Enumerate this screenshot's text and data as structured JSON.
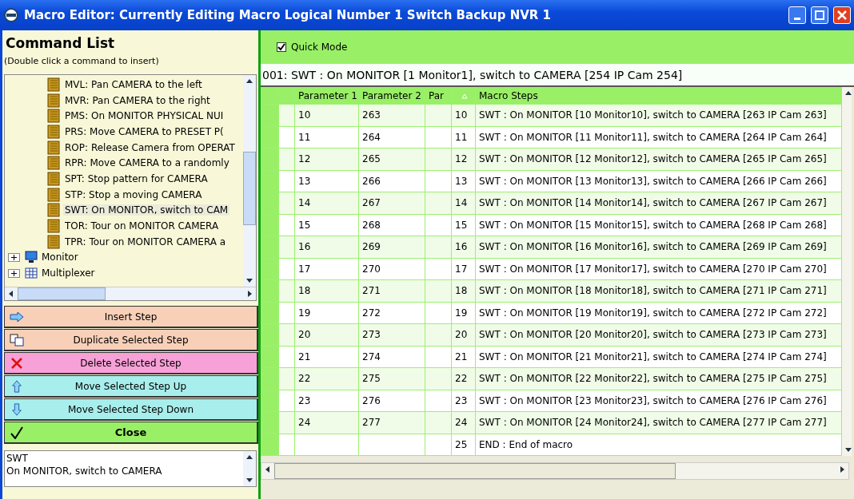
{
  "window": {
    "title": "Macro Editor: Currently Editing Macro Logical Number 1 Switch Backup NVR 1"
  },
  "command_list": {
    "title": "Command List",
    "hint": "(Double click a command to insert)",
    "commands": [
      {
        "label": "MVL: Pan CAMERA to the left",
        "selected": false
      },
      {
        "label": "MVR: Pan CAMERA to the right",
        "selected": false
      },
      {
        "label": "PMS: On MONITOR PHYSICAL NUI",
        "selected": false
      },
      {
        "label": "PRS: Move CAMERA to PRESET P(",
        "selected": false
      },
      {
        "label": "ROP: Release Camera from OPERAT",
        "selected": false
      },
      {
        "label": "RPR: Move CAMERA to a randomly",
        "selected": false
      },
      {
        "label": "SPT: Stop pattern for CAMERA",
        "selected": false
      },
      {
        "label": "STP: Stop a moving CAMERA",
        "selected": false
      },
      {
        "label": "SWT: On MONITOR, switch to CAM",
        "selected": true
      },
      {
        "label": "TOR: Tour on MONITOR CAMERA",
        "selected": false
      },
      {
        "label": "TPR: Tour on MONITOR CAMERA a",
        "selected": false
      }
    ],
    "groups": [
      {
        "label": "Monitor",
        "kind": "monitor",
        "expanded": false
      },
      {
        "label": "Multiplexer",
        "kind": "grid",
        "expanded": false
      }
    ]
  },
  "buttons": [
    {
      "label": "Insert Step",
      "kind": "insert",
      "color": "#f8d0b8"
    },
    {
      "label": "Duplicate Selected Step",
      "kind": "duplicate",
      "color": "#f8d0b8"
    },
    {
      "label": "Delete Selected Step",
      "kind": "delete",
      "color": "#f8a0d8"
    },
    {
      "label": "Move Selected Step Up",
      "kind": "up",
      "color": "#a8eeec"
    },
    {
      "label": "Move Selected Step Down",
      "kind": "down",
      "color": "#a8eeec"
    },
    {
      "label": "Close",
      "kind": "close",
      "color": "#99f066"
    }
  ],
  "description": {
    "lines": [
      "SWT",
      "On MONITOR, switch to CAMERA"
    ]
  },
  "quick_mode": {
    "label": "Quick Mode",
    "checked": true
  },
  "current_step": "001: SWT : On MONITOR [1 Monitor1], switch to CAMERA [254 IP Cam 254]",
  "table": {
    "columns": [
      "Parameter 1",
      "Parameter 2",
      "Par",
      "Macro Steps"
    ],
    "rows": [
      {
        "p1": "10",
        "p2": "263",
        "step": "10",
        "text": "SWT : On MONITOR [10 Monitor10], switch to CAMERA [263 IP Cam 263]"
      },
      {
        "p1": "11",
        "p2": "264",
        "step": "11",
        "text": "SWT : On MONITOR [11 Monitor11], switch to CAMERA [264 IP Cam 264]"
      },
      {
        "p1": "12",
        "p2": "265",
        "step": "12",
        "text": "SWT : On MONITOR [12 Monitor12], switch to CAMERA [265 IP Cam 265]"
      },
      {
        "p1": "13",
        "p2": "266",
        "step": "13",
        "text": "SWT : On MONITOR [13 Monitor13], switch to CAMERA [266 IP Cam 266]"
      },
      {
        "p1": "14",
        "p2": "267",
        "step": "14",
        "text": "SWT : On MONITOR [14 Monitor14], switch to CAMERA [267 IP Cam 267]"
      },
      {
        "p1": "15",
        "p2": "268",
        "step": "15",
        "text": "SWT : On MONITOR [15 Monitor15], switch to CAMERA [268 IP Cam 268]"
      },
      {
        "p1": "16",
        "p2": "269",
        "step": "16",
        "text": "SWT : On MONITOR [16 Monitor16], switch to CAMERA [269 IP Cam 269]"
      },
      {
        "p1": "17",
        "p2": "270",
        "step": "17",
        "text": "SWT : On MONITOR [17 Monitor17], switch to CAMERA [270 IP Cam 270]"
      },
      {
        "p1": "18",
        "p2": "271",
        "step": "18",
        "text": "SWT : On MONITOR [18 Monitor18], switch to CAMERA [271 IP Cam 271]"
      },
      {
        "p1": "19",
        "p2": "272",
        "step": "19",
        "text": "SWT : On MONITOR [19 Monitor19], switch to CAMERA [272 IP Cam 272]"
      },
      {
        "p1": "20",
        "p2": "273",
        "step": "20",
        "text": "SWT : On MONITOR [20 Monitor20], switch to CAMERA [273 IP Cam 273]"
      },
      {
        "p1": "21",
        "p2": "274",
        "step": "21",
        "text": "SWT : On MONITOR [21 Monitor21], switch to CAMERA [274 IP Cam 274]"
      },
      {
        "p1": "22",
        "p2": "275",
        "step": "22",
        "text": "SWT : On MONITOR [22 Monitor22], switch to CAMERA [275 IP Cam 275]"
      },
      {
        "p1": "23",
        "p2": "276",
        "step": "23",
        "text": "SWT : On MONITOR [23 Monitor23], switch to CAMERA [276 IP Cam 276]"
      },
      {
        "p1": "24",
        "p2": "277",
        "step": "24",
        "text": "SWT : On MONITOR [24 Monitor24], switch to CAMERA [277 IP Cam 277]"
      },
      {
        "step": "25",
        "text": "END : End of macro"
      }
    ]
  }
}
